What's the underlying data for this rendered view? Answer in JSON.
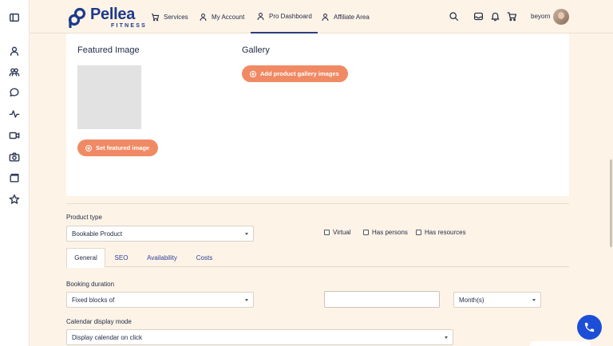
{
  "header": {
    "logo_name": "Pellea",
    "logo_sub": "FITNESS",
    "nav": [
      {
        "label": "Services",
        "icon": "cart-icon"
      },
      {
        "label": "My Account",
        "icon": "user-icon"
      },
      {
        "label": "Pro Dashboard",
        "icon": "user-icon"
      },
      {
        "label": "Affiliate Area",
        "icon": "user-icon"
      }
    ],
    "username": "beyorn"
  },
  "sidebar": {
    "icons": [
      "sidebar-toggle-icon",
      "user-icon",
      "group-icon",
      "chat-icon",
      "activity-icon",
      "video-icon",
      "camera-icon",
      "folder-icon",
      "star-icon"
    ]
  },
  "media": {
    "featured_title": "Featured Image",
    "featured_button": "Set featured image",
    "gallery_title": "Gallery",
    "gallery_button": "Add product gallery images"
  },
  "product": {
    "type_label": "Product type",
    "type_value": "Bookable Product",
    "checkboxes": [
      {
        "label": "Virtual",
        "checked": false
      },
      {
        "label": "Has persons",
        "checked": false
      },
      {
        "label": "Has resources",
        "checked": false
      }
    ],
    "tabs": [
      "General",
      "SEO",
      "Availability",
      "Costs"
    ],
    "active_tab": "General",
    "duration_label": "Booking duration",
    "duration_value": "Fixed blocks of",
    "duration_amount": "",
    "duration_unit": "Month(s)",
    "calendar_label": "Calendar display mode",
    "calendar_value": "Display calendar on click"
  },
  "colors": {
    "accent": "#f08a64",
    "brand": "#1e3a8a",
    "background": "#fdf3e7",
    "phone_button": "#1d4ed8"
  }
}
